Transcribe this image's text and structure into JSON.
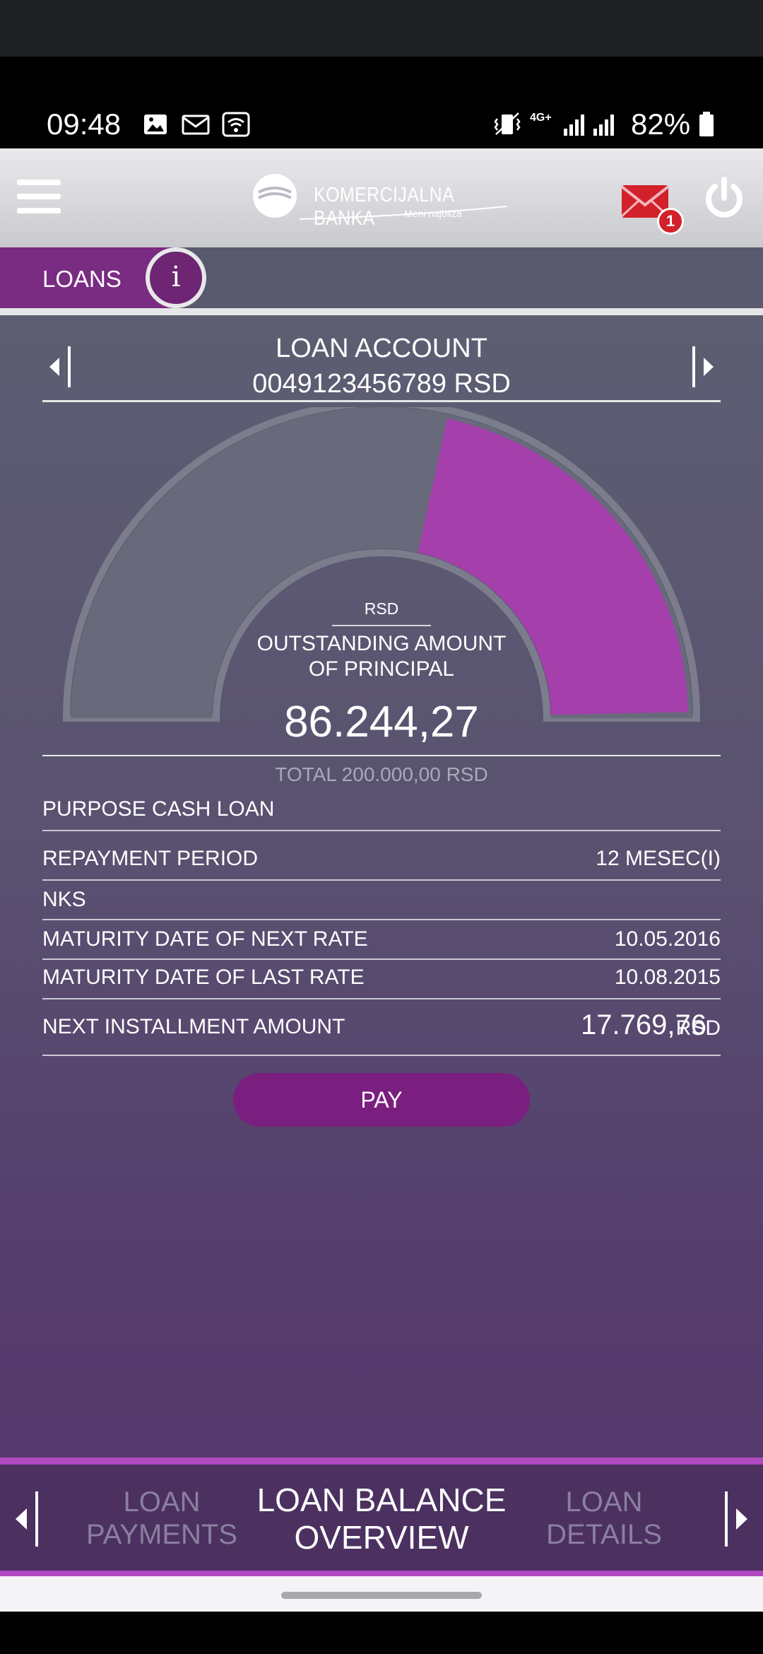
{
  "status_bar": {
    "time": "09:48",
    "battery": "82%",
    "network": "4G+",
    "icons": [
      "image-icon",
      "mail-icon",
      "wifi-icon",
      "vibrate-icon",
      "signal-icon",
      "battery-icon"
    ]
  },
  "header": {
    "logo_name": "KOMERCIJALNA BANKA",
    "logo_tagline": "Meni najbliža",
    "mail_badge": "1"
  },
  "section": {
    "title": "LOANS",
    "info_label": "i"
  },
  "account": {
    "title": "LOAN ACCOUNT",
    "number": "0049123456789 RSD"
  },
  "gauge": {
    "currency": "RSD",
    "label_line1": "OUTSTANDING AMOUNT",
    "label_line2": "OF PRINCIPAL",
    "amount": "86.244,27",
    "total": "TOTAL 200.000,00 RSD",
    "outstanding_value": 86244.27,
    "total_value": 200000.0,
    "colors": {
      "track": "#686a7c",
      "fill": "#a43fab",
      "border": "#7c7d8c"
    }
  },
  "details": {
    "purpose": "PURPOSE CASH LOAN",
    "repayment_label": "REPAYMENT PERIOD",
    "repayment_value": "12 MESEC(I)",
    "nks_label": "NKS",
    "next_rate_label": "MATURITY DATE OF NEXT RATE",
    "next_rate_value": "10.05.2016",
    "last_rate_label": "MATURITY DATE OF LAST RATE",
    "last_rate_value": "10.08.2015",
    "installment_label": "NEXT INSTALLMENT AMOUNT",
    "installment_value": "17.769,76",
    "installment_currency": "RSD"
  },
  "actions": {
    "pay_label": "PAY"
  },
  "bottom_nav": {
    "prev": {
      "line1": "LOAN",
      "line2": "PAYMENTS"
    },
    "current": {
      "line1": "LOAN BALANCE",
      "line2": "OVERVIEW"
    },
    "next": {
      "line1": "LOAN",
      "line2": "DETAILS"
    }
  }
}
